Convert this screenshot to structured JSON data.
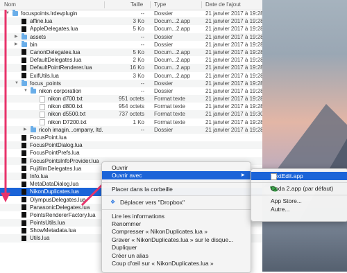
{
  "header": {
    "name": "Nom",
    "size": "Taille",
    "kind": "Type",
    "date": "Date de l'ajout"
  },
  "rows": [
    {
      "indent": 0,
      "tri": "▼",
      "icon": "folder",
      "name": "focuspoints.lrdevplugin",
      "size": "--",
      "kind": "Dossier",
      "date": "21 janvier 2017 à 19:28"
    },
    {
      "indent": 1,
      "tri": "",
      "icon": "lua",
      "name": "affine.lua",
      "size": "3 Ko",
      "kind": "Docum...2.app",
      "date": "21 janvier 2017 à 19:28"
    },
    {
      "indent": 1,
      "tri": "",
      "icon": "lua",
      "name": "AppleDelegates.lua",
      "size": "5 Ko",
      "kind": "Docum...2.app",
      "date": "21 janvier 2017 à 19:28"
    },
    {
      "indent": 1,
      "tri": "▶",
      "icon": "folder",
      "name": "assets",
      "size": "--",
      "kind": "Dossier",
      "date": "21 janvier 2017 à 19:28"
    },
    {
      "indent": 1,
      "tri": "▶",
      "icon": "folder",
      "name": "bin",
      "size": "--",
      "kind": "Dossier",
      "date": "21 janvier 2017 à 19:28"
    },
    {
      "indent": 1,
      "tri": "",
      "icon": "lua",
      "name": "CanonDelegates.lua",
      "size": "5 Ko",
      "kind": "Docum...2.app",
      "date": "21 janvier 2017 à 19:28"
    },
    {
      "indent": 1,
      "tri": "",
      "icon": "lua",
      "name": "DefaultDelegates.lua",
      "size": "2 Ko",
      "kind": "Docum...2.app",
      "date": "21 janvier 2017 à 19:28"
    },
    {
      "indent": 1,
      "tri": "",
      "icon": "lua",
      "name": "DefaultPointRenderer.lua",
      "size": "16 Ko",
      "kind": "Docum...2.app",
      "date": "21 janvier 2017 à 19:28"
    },
    {
      "indent": 1,
      "tri": "",
      "icon": "lua",
      "name": "ExifUtils.lua",
      "size": "3 Ko",
      "kind": "Docum...2.app",
      "date": "21 janvier 2017 à 19:28"
    },
    {
      "indent": 1,
      "tri": "▼",
      "icon": "folder",
      "name": "focus_points",
      "size": "--",
      "kind": "Dossier",
      "date": "21 janvier 2017 à 19:28"
    },
    {
      "indent": 2,
      "tri": "▼",
      "icon": "folder",
      "name": "nikon corporation",
      "size": "--",
      "kind": "Dossier",
      "date": "21 janvier 2017 à 19:28"
    },
    {
      "indent": 3,
      "tri": "",
      "icon": "txt",
      "name": "nikon d700.txt",
      "size": "951 octets",
      "kind": "Format texte",
      "date": "21 janvier 2017 à 19:28"
    },
    {
      "indent": 3,
      "tri": "",
      "icon": "txt",
      "name": "nikon d800.txt",
      "size": "954 octets",
      "kind": "Format texte",
      "date": "21 janvier 2017 à 19:28"
    },
    {
      "indent": 3,
      "tri": "",
      "icon": "txt",
      "name": "nikon d5500.txt",
      "size": "737 octets",
      "kind": "Format texte",
      "date": "21 janvier 2017 à 19:30"
    },
    {
      "indent": 3,
      "tri": "",
      "icon": "txt",
      "name": "nikon D7200.txt",
      "size": "1 Ko",
      "kind": "Format texte",
      "date": "21 janvier 2017 à 19:28"
    },
    {
      "indent": 2,
      "tri": "▶",
      "icon": "folder",
      "name": "ricoh imagin...ompany, ltd.",
      "size": "--",
      "kind": "Dossier",
      "date": "21 janvier 2017 à 19:28"
    },
    {
      "indent": 1,
      "tri": "",
      "icon": "lua",
      "name": "FocusPoint.lua",
      "size": "",
      "kind": "",
      "date": ""
    },
    {
      "indent": 1,
      "tri": "",
      "icon": "lua",
      "name": "FocusPointDialog.lua",
      "size": "",
      "kind": "",
      "date": ""
    },
    {
      "indent": 1,
      "tri": "",
      "icon": "lua",
      "name": "FocusPointPrefs.lua",
      "size": "",
      "kind": "",
      "date": ""
    },
    {
      "indent": 1,
      "tri": "",
      "icon": "lua",
      "name": "FocusPointsInfoProvider.lua",
      "size": "",
      "kind": "",
      "date": ""
    },
    {
      "indent": 1,
      "tri": "",
      "icon": "lua",
      "name": "FujifilmDelegates.lua",
      "size": "",
      "kind": "",
      "date": ""
    },
    {
      "indent": 1,
      "tri": "",
      "icon": "lua",
      "name": "Info.lua",
      "size": "",
      "kind": "",
      "date": ""
    },
    {
      "indent": 1,
      "tri": "",
      "icon": "lua",
      "name": "MetaDataDialog.lua",
      "size": "",
      "kind": "",
      "date": ""
    },
    {
      "indent": 1,
      "tri": "",
      "icon": "lua",
      "name": "NikonDuplicates.lua",
      "size": "",
      "kind": "",
      "date": "",
      "selected": true
    },
    {
      "indent": 1,
      "tri": "",
      "icon": "lua",
      "name": "OlympusDelegates.lua",
      "size": "",
      "kind": "",
      "date": ""
    },
    {
      "indent": 1,
      "tri": "",
      "icon": "lua",
      "name": "PanasonicDelegates.lua",
      "size": "",
      "kind": "",
      "date": ""
    },
    {
      "indent": 1,
      "tri": "",
      "icon": "lua",
      "name": "PointsRendererFactory.lua",
      "size": "",
      "kind": "",
      "date": ""
    },
    {
      "indent": 1,
      "tri": "",
      "icon": "lua",
      "name": "PointsUtils.lua",
      "size": "",
      "kind": "",
      "date": ""
    },
    {
      "indent": 1,
      "tri": "",
      "icon": "lua",
      "name": "ShowMetadata.lua",
      "size": "",
      "kind": "",
      "date": ""
    },
    {
      "indent": 1,
      "tri": "",
      "icon": "lua",
      "name": "Utils.lua",
      "size": "",
      "kind": "",
      "date": ""
    }
  ],
  "context_menu": {
    "items": [
      {
        "label": "Ouvrir"
      },
      {
        "label": "Ouvrir avec",
        "highlighted": true,
        "submenu": true
      },
      {
        "separator": true
      },
      {
        "label": "Placer dans la corbeille"
      },
      {
        "separator": true
      },
      {
        "label": "Déplacer vers \"Dropbox\"",
        "icon": "dropbox-icon"
      },
      {
        "separator": true
      },
      {
        "label": "Lire les informations"
      },
      {
        "label": "Renommer"
      },
      {
        "label": "Compresser « NikonDuplicates.lua »"
      },
      {
        "label": "Graver « NikonDuplicates.lua » sur le disque..."
      },
      {
        "label": "Dupliquer"
      },
      {
        "label": "Créer un alias"
      },
      {
        "label": "Coup d'œil sur « NikonDuplicates.lua »"
      }
    ]
  },
  "open_with_submenu": {
    "items": [
      {
        "label": "TextEdit.app",
        "icon": "textedit-icon",
        "highlighted": true
      },
      {
        "separator": true
      },
      {
        "label": "Coda 2.app (par défaut)",
        "icon": "coda-icon"
      },
      {
        "separator": true
      },
      {
        "label": "App Store..."
      },
      {
        "label": "Autre..."
      }
    ]
  },
  "colors": {
    "selection": "#1b64d8",
    "annotation_arrow": "#e8336b"
  }
}
